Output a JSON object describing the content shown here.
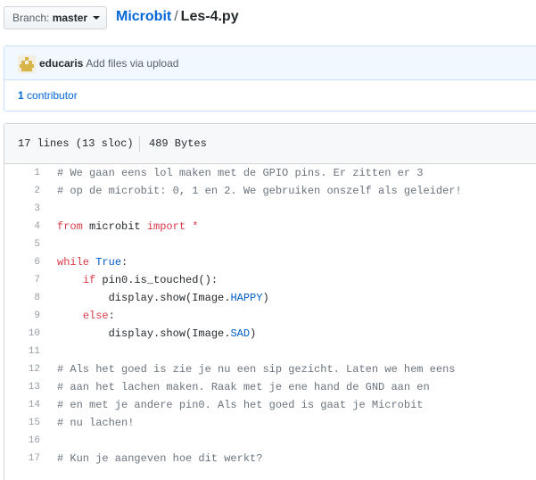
{
  "header": {
    "branch_prefix": "Branch:",
    "branch_name": "master",
    "repo_name": "Microbit",
    "path_separator": "/",
    "file_name": "Les-4.py"
  },
  "commit": {
    "author": "educaris",
    "message": "Add files via upload",
    "contributors_count": "1",
    "contributors_label": "contributor"
  },
  "file_info": {
    "lines_summary": "17 lines (13 sloc)",
    "size": "489 Bytes"
  },
  "colors": {
    "link": "#0366d6",
    "keyword": "#d73a49",
    "constant": "#005cc5",
    "comment": "#6a737d"
  },
  "code_lines": [
    {
      "num": "1",
      "tokens": [
        {
          "t": "comment",
          "v": "# We gaan eens lol maken met de GPIO pins. Er zitten er 3"
        }
      ]
    },
    {
      "num": "2",
      "tokens": [
        {
          "t": "comment",
          "v": "# op de microbit: 0, 1 en 2. We gebruiken onszelf als geleider!"
        }
      ]
    },
    {
      "num": "3",
      "tokens": []
    },
    {
      "num": "4",
      "tokens": [
        {
          "t": "kw",
          "v": "from"
        },
        {
          "t": "plain",
          "v": " microbit "
        },
        {
          "t": "kw",
          "v": "import"
        },
        {
          "t": "plain",
          "v": " "
        },
        {
          "t": "kw",
          "v": "*"
        }
      ]
    },
    {
      "num": "5",
      "tokens": []
    },
    {
      "num": "6",
      "tokens": [
        {
          "t": "kw",
          "v": "while"
        },
        {
          "t": "plain",
          "v": " "
        },
        {
          "t": "const",
          "v": "True"
        },
        {
          "t": "plain",
          "v": ":"
        }
      ]
    },
    {
      "num": "7",
      "tokens": [
        {
          "t": "plain",
          "v": "    "
        },
        {
          "t": "kw",
          "v": "if"
        },
        {
          "t": "plain",
          "v": " pin0.is_touched():"
        }
      ]
    },
    {
      "num": "8",
      "tokens": [
        {
          "t": "plain",
          "v": "        display.show(Image."
        },
        {
          "t": "const",
          "v": "HAPPY"
        },
        {
          "t": "plain",
          "v": ")"
        }
      ]
    },
    {
      "num": "9",
      "tokens": [
        {
          "t": "plain",
          "v": "    "
        },
        {
          "t": "kw",
          "v": "else"
        },
        {
          "t": "plain",
          "v": ":"
        }
      ]
    },
    {
      "num": "10",
      "tokens": [
        {
          "t": "plain",
          "v": "        display.show(Image."
        },
        {
          "t": "const",
          "v": "SAD"
        },
        {
          "t": "plain",
          "v": ")"
        }
      ]
    },
    {
      "num": "11",
      "tokens": []
    },
    {
      "num": "12",
      "tokens": [
        {
          "t": "comment",
          "v": "# Als het goed is zie je nu een sip gezicht. Laten we hem eens"
        }
      ]
    },
    {
      "num": "13",
      "tokens": [
        {
          "t": "comment",
          "v": "# aan het lachen maken. Raak met je ene hand de GND aan en"
        }
      ]
    },
    {
      "num": "14",
      "tokens": [
        {
          "t": "comment",
          "v": "# en met je andere pin0. Als het goed is gaat je Microbit"
        }
      ]
    },
    {
      "num": "15",
      "tokens": [
        {
          "t": "comment",
          "v": "# nu lachen!"
        }
      ]
    },
    {
      "num": "16",
      "tokens": []
    },
    {
      "num": "17",
      "tokens": [
        {
          "t": "comment",
          "v": "# Kun je aangeven hoe dit werkt?"
        }
      ]
    }
  ]
}
